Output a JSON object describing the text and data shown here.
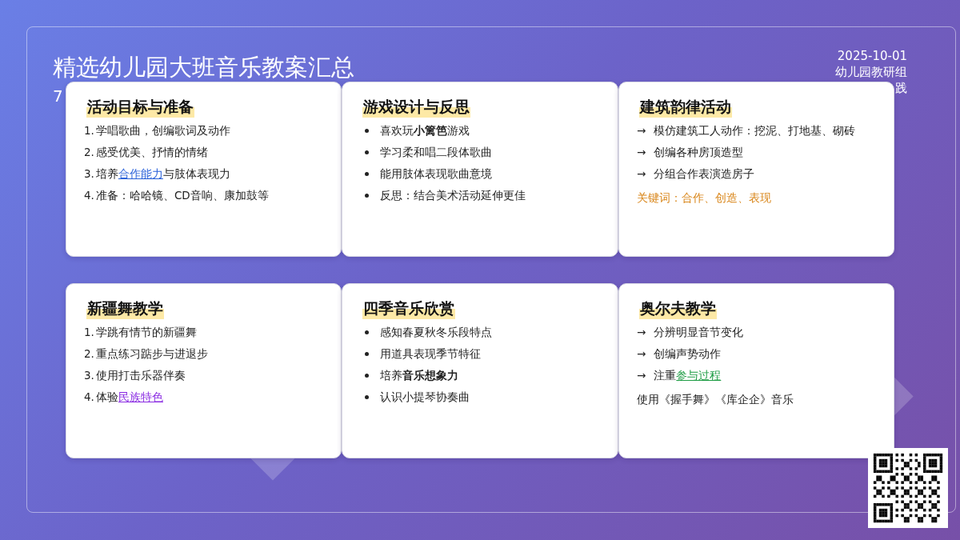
{
  "header": {
    "title": "精选幼儿园大班音乐教案汇总",
    "subtitle": "7",
    "date": "2025-10-01",
    "author": "幼儿园教研组",
    "tagline": "践"
  },
  "cards": [
    {
      "title": "活动目标与准备",
      "kind": "ordered",
      "items": [
        {
          "marker": "1.",
          "text": "学唱歌曲，创编歌词及动作"
        },
        {
          "marker": "2.",
          "text": "感受优美、抒情的情绪"
        },
        {
          "marker": "3.",
          "text": "培养",
          "link": {
            "text": "合作能力",
            "color": "#2b62d9"
          },
          "tail": "与肢体表现力"
        },
        {
          "marker": "4.",
          "text": "准备：哈哈镜、CD音响、康加鼓等"
        }
      ]
    },
    {
      "title": "游戏设计与反思",
      "kind": "bullet",
      "items": [
        {
          "text": "喜欢玩**小篱笆**游戏"
        },
        {
          "text": "学习柔和唱二段体歌曲"
        },
        {
          "text": "能用肢体表现歌曲意境"
        },
        {
          "text": "反思：结合美术活动延伸更佳"
        }
      ]
    },
    {
      "title": "建筑韵律活动",
      "kind": "arrow",
      "items": [
        {
          "marker": "→",
          "text": "模仿建筑工人动作：挖泥、打地基、砌砖"
        },
        {
          "marker": "→",
          "text": "创编各种房顶造型"
        },
        {
          "marker": "→",
          "text": "分组合作表演造房子"
        }
      ],
      "note": {
        "text": "关键词：合作、创造、表现",
        "kind": "keyword"
      }
    },
    {
      "title": "新疆舞教学",
      "kind": "ordered",
      "items": [
        {
          "marker": "1.",
          "text": "学跳有情节的新疆舞"
        },
        {
          "marker": "2.",
          "text": "重点练习踮步与进退步"
        },
        {
          "marker": "3.",
          "text": "使用打击乐器伴奏"
        },
        {
          "marker": "4.",
          "text": "体验",
          "link": {
            "text": "民族特色",
            "color": "#8a2be2"
          }
        }
      ]
    },
    {
      "title": "四季音乐欣赏",
      "kind": "bullet",
      "items": [
        {
          "text": "感知春夏秋冬乐段特点"
        },
        {
          "text": "用道具表现季节特征"
        },
        {
          "text": "培养**音乐想象力**"
        },
        {
          "text": "认识小提琴协奏曲"
        }
      ]
    },
    {
      "title": "奥尔夫教学",
      "kind": "arrow",
      "items": [
        {
          "marker": "→",
          "text": "分辨明显音节变化"
        },
        {
          "marker": "→",
          "text": "创编声势动作"
        },
        {
          "marker": "→",
          "text": "注重",
          "link": {
            "text": "参与过程",
            "color": "#1f9d45"
          }
        }
      ],
      "note": {
        "text": "使用《握手舞》《库企企》音乐",
        "kind": "plain"
      }
    }
  ]
}
